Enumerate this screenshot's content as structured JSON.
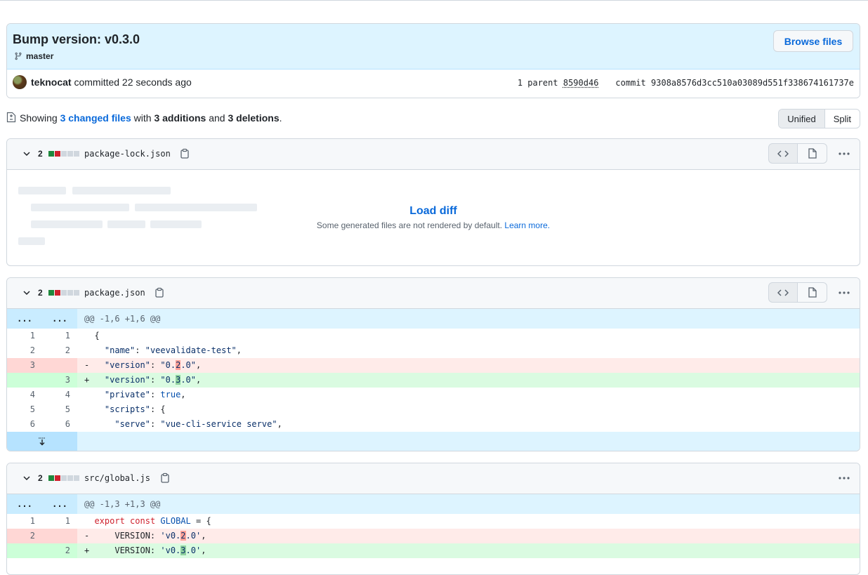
{
  "commit": {
    "title": "Bump version: v0.3.0",
    "branch": "master",
    "browse_label": "Browse files",
    "author": "teknocat",
    "action": "committed 22 seconds ago",
    "parent_label": "1 parent",
    "parent_sha": "8590d46",
    "commit_label": "commit",
    "commit_sha": "9308a8576d3cc510a03089d551f338674161737e"
  },
  "summary": {
    "prefix": "Showing",
    "changed": "3 changed files",
    "with": "with",
    "additions": "3 additions",
    "and": "and",
    "deletions": "3 deletions",
    "period": ".",
    "view_unified": "Unified",
    "view_split": "Split"
  },
  "files": [
    {
      "count": "2",
      "name": "package-lock.json",
      "load_label": "Load diff",
      "note": "Some generated files are not rendered by default.",
      "learn_more": "Learn more."
    },
    {
      "count": "2",
      "name": "package.json",
      "hunk": "@@ -1,6 +1,6 @@",
      "hunk_ellipsis": "..."
    },
    {
      "count": "2",
      "name": "src/global.js",
      "hunk": "@@ -1,3 +1,3 @@",
      "hunk_ellipsis": "..."
    }
  ],
  "diff1": [
    {
      "type": "ctx",
      "old": "1",
      "new": "1",
      "sign": " ",
      "code": "{"
    },
    {
      "type": "ctx",
      "old": "2",
      "new": "2",
      "sign": " ",
      "code": "  \"name\": \"veevalidate-test\","
    },
    {
      "type": "del",
      "old": "3",
      "new": "",
      "sign": "-",
      "code": "  \"version\": \"0.2.0\","
    },
    {
      "type": "add",
      "old": "",
      "new": "3",
      "sign": "+",
      "code": "  \"version\": \"0.3.0\","
    },
    {
      "type": "ctx",
      "old": "4",
      "new": "4",
      "sign": " ",
      "code": "  \"private\": true,"
    },
    {
      "type": "ctx",
      "old": "5",
      "new": "5",
      "sign": " ",
      "code": "  \"scripts\": {"
    },
    {
      "type": "ctx",
      "old": "6",
      "new": "6",
      "sign": " ",
      "code": "    \"serve\": \"vue-cli-service serve\","
    }
  ],
  "diff2": [
    {
      "type": "ctx",
      "old": "1",
      "new": "1",
      "sign": " ",
      "code": "export const GLOBAL = {"
    },
    {
      "type": "del",
      "old": "2",
      "new": "",
      "sign": "-",
      "code": "    VERSION: 'v0.2.0',"
    },
    {
      "type": "add",
      "old": "",
      "new": "2",
      "sign": "+",
      "code": "    VERSION: 'v0.3.0',"
    }
  ],
  "icons": {
    "branch": "git-branch-icon",
    "file_diff": "file-diff-icon",
    "chevron": "chevron-down-icon",
    "copy": "copy-icon",
    "code": "code-icon",
    "file": "file-icon",
    "kebab": "kebab-horizontal-icon",
    "expand": "unfold-icon"
  },
  "colors": {
    "accent": "#0969da",
    "addition": "#1f883d",
    "deletion": "#cf222e"
  }
}
